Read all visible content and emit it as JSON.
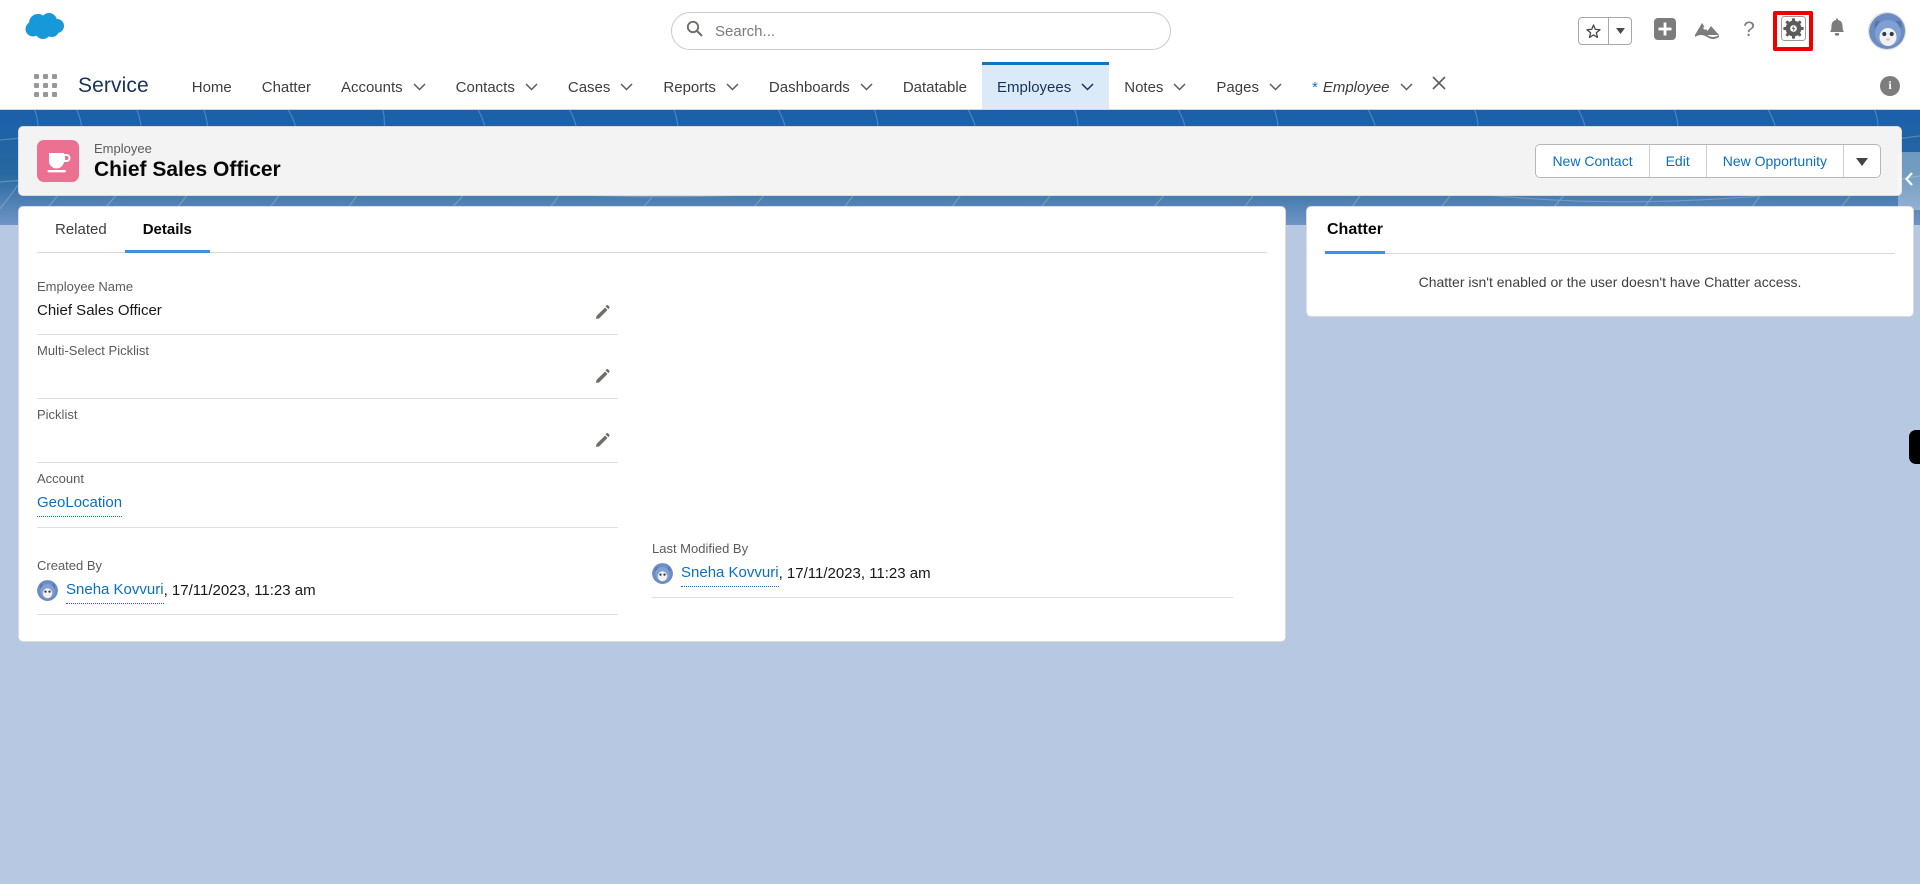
{
  "header": {
    "logo_icon": "salesforce-cloud-logo",
    "search": {
      "placeholder": "Search...",
      "value": "",
      "icon": "search-icon"
    },
    "actions": [
      {
        "name": "favorites-star",
        "icon": "star-icon",
        "label": "Favorites"
      },
      {
        "name": "favorites-caret",
        "icon": "chevron-down-icon",
        "label": "Favorites list"
      },
      {
        "name": "global-create",
        "icon": "plus-icon",
        "label": "Global Actions"
      },
      {
        "name": "einstein",
        "icon": "einstein-mountain-icon",
        "label": "Einstein"
      },
      {
        "name": "help",
        "icon": "question-mark-icon",
        "label": "Help"
      },
      {
        "name": "setup",
        "icon": "gear-icon",
        "label": "Setup",
        "highlighted": true
      },
      {
        "name": "notifications",
        "icon": "bell-icon",
        "label": "Notifications"
      },
      {
        "name": "user-profile",
        "icon": "avatar-icon",
        "label": "View profile"
      }
    ],
    "highlight_color": "#ee0000"
  },
  "nav": {
    "app_launcher_icon": "app-launcher-waffle-icon",
    "app_name": "Service",
    "items": [
      {
        "label": "Home",
        "has_caret": false,
        "active": false
      },
      {
        "label": "Chatter",
        "has_caret": false,
        "active": false
      },
      {
        "label": "Accounts",
        "has_caret": true,
        "active": false
      },
      {
        "label": "Contacts",
        "has_caret": true,
        "active": false
      },
      {
        "label": "Cases",
        "has_caret": true,
        "active": false
      },
      {
        "label": "Reports",
        "has_caret": true,
        "active": false
      },
      {
        "label": "Dashboards",
        "has_caret": true,
        "active": false
      },
      {
        "label": "Datatable",
        "has_caret": false,
        "active": false
      },
      {
        "label": "Employees",
        "has_caret": true,
        "active": true
      },
      {
        "label": "Notes",
        "has_caret": true,
        "active": false
      },
      {
        "label": "Pages",
        "has_caret": true,
        "active": false
      }
    ],
    "temp_tab": {
      "modified_marker": "*",
      "label": "Employee",
      "has_caret": true,
      "closable": true
    },
    "info_icon": "info-icon",
    "active_color": "#0b76c8",
    "active_bg": "#dbeaf8"
  },
  "record": {
    "icon": "coffee-cup-icon",
    "icon_color": "#eb7092",
    "object_label": "Employee",
    "title": "Chief Sales Officer",
    "actions": [
      {
        "label": "New Contact"
      },
      {
        "label": "Edit"
      },
      {
        "label": "New Opportunity"
      }
    ],
    "more_actions_icon": "caret-down-icon"
  },
  "detail_panel": {
    "tabs": [
      {
        "label": "Related",
        "active": false
      },
      {
        "label": "Details",
        "active": true
      }
    ],
    "fields_left": [
      {
        "label": "Employee Name",
        "value": "Chief Sales Officer",
        "editable": true,
        "type": "text"
      },
      {
        "label": "Multi-Select Picklist",
        "value": "",
        "editable": true,
        "type": "text"
      },
      {
        "label": "Picklist",
        "value": "",
        "editable": true,
        "type": "text"
      },
      {
        "label": "Account",
        "value": "GeoLocation",
        "editable": false,
        "type": "link"
      }
    ],
    "created_by": {
      "label": "Created By",
      "user": "Sneha Kovvuri",
      "timestamp": ", 17/11/2023, 11:23 am",
      "avatar_icon": "user-avatar-icon"
    },
    "last_modified_by": {
      "label": "Last Modified By",
      "user": "Sneha Kovvuri",
      "timestamp": ", 17/11/2023, 11:23 am",
      "avatar_icon": "user-avatar-icon"
    },
    "edit_icon": "pencil-icon",
    "link_color": "#0b6fc0"
  },
  "chatter_panel": {
    "tab_label": "Chatter",
    "message": "Chatter isn't enabled or the user doesn't have Chatter access."
  },
  "edges": {
    "collapse_handle_icon": "chevron-left-icon",
    "edge_tab_name": "right-edge-tab"
  }
}
